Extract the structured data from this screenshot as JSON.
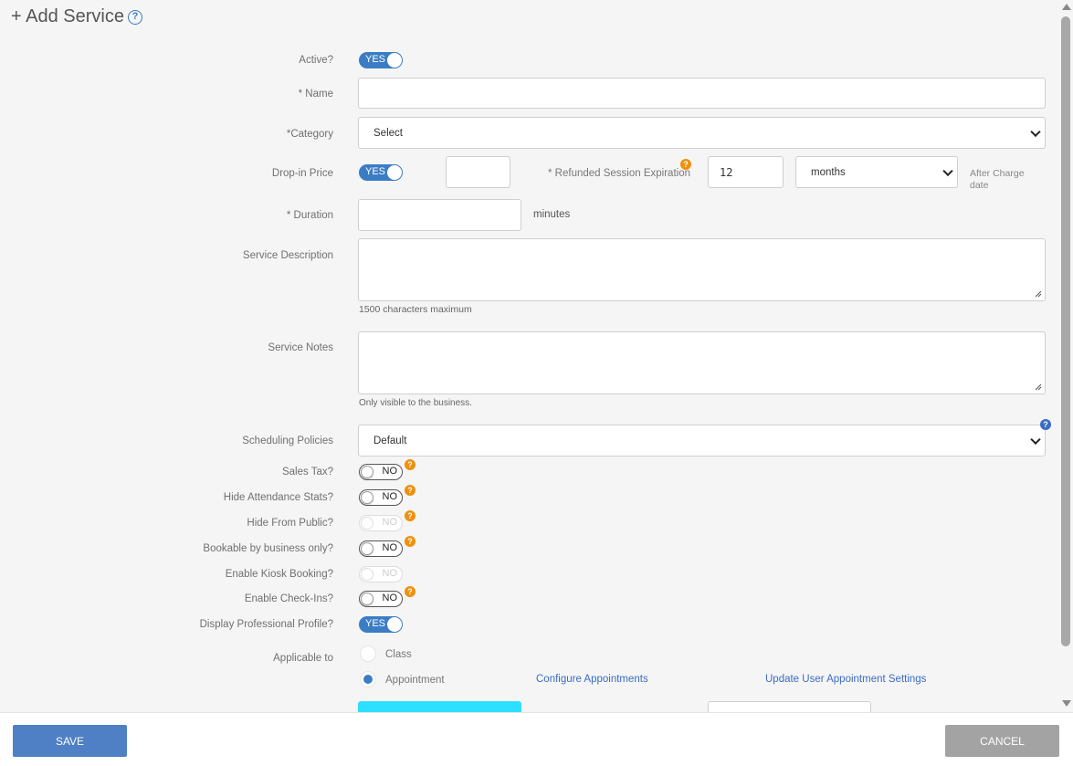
{
  "header": {
    "title": "+ Add Service",
    "help": "?"
  },
  "form": {
    "active": {
      "label": "Active?",
      "value": "YES"
    },
    "name": {
      "label": "* Name",
      "value": ""
    },
    "category": {
      "label": "*Category",
      "value": "Select"
    },
    "dropin": {
      "label": "Drop-in Price",
      "toggle": "YES",
      "price": "",
      "refund_label": "* Refunded Session Expiration",
      "refund_value": "12",
      "refund_unit": "months",
      "after_note": "After Charge date"
    },
    "duration": {
      "label": "* Duration",
      "value": "",
      "unit": "minutes"
    },
    "description": {
      "label": "Service Description",
      "hint": "1500 characters maximum"
    },
    "notes": {
      "label": "Service Notes",
      "hint": "Only visible to the business."
    },
    "policies": {
      "label": "Scheduling Policies",
      "value": "Default"
    },
    "toggles": [
      {
        "label": "Sales Tax?",
        "value": "NO"
      },
      {
        "label": "Hide Attendance Stats?",
        "value": "NO"
      },
      {
        "label": "Hide From Public?",
        "value": "NO"
      },
      {
        "label": "Bookable by business only?",
        "value": "NO"
      },
      {
        "label": "Enable Kiosk Booking?",
        "value": "NO"
      },
      {
        "label": "Enable Check-Ins?",
        "value": "NO"
      },
      {
        "label": "Display Professional Profile?",
        "value": "YES"
      }
    ],
    "applicable": {
      "label": "Applicable to",
      "options": [
        "Class",
        "Appointment"
      ],
      "selected": "Appointment",
      "link_configure": "Configure Appointments",
      "link_update": "Update User Appointment Settings"
    }
  },
  "footer": {
    "save": "SAVE",
    "cancel": "CANCEL"
  },
  "colors": {
    "accent": "#3b7dc4",
    "help": "#f0900c",
    "cyan": "#2ee0ff",
    "save": "#4f7fc4",
    "cancel": "#a3a3a3"
  }
}
